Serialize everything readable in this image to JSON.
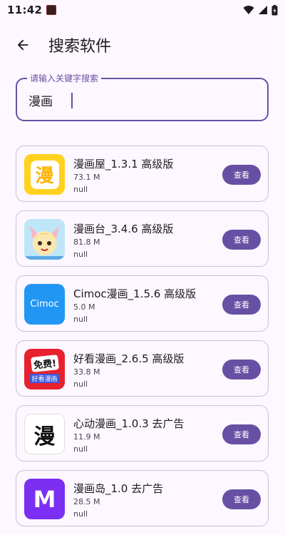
{
  "status_bar": {
    "time": "11:42",
    "icons": [
      "app-notification-icon",
      "wifi-icon",
      "cellular-signal-icon",
      "battery-icon"
    ]
  },
  "header": {
    "back_icon": "arrow-back-icon",
    "title": "搜索软件"
  },
  "search": {
    "label": "请输入关键字搜索",
    "value": "漫画"
  },
  "apps": [
    {
      "name": "漫画屋_1.3.1 高级版",
      "size": "73.1 M",
      "desc": "null",
      "button": "查看",
      "icon_text": "漫",
      "icon_bg": "#ffd21f",
      "icon_fg": "#ffffff"
    },
    {
      "name": "漫画台_3.4.6 高级版",
      "size": "81.8 M",
      "desc": "null",
      "button": "查看",
      "icon_text": "",
      "icon_bg": "#bfe6f7",
      "icon_fg": "#ffffff"
    },
    {
      "name": "Cimoc漫画_1.5.6 高级版",
      "size": "5.0 M",
      "desc": "null",
      "button": "查看",
      "icon_text": "Cimoc",
      "icon_bg": "#2196f3",
      "icon_fg": "#ffffff"
    },
    {
      "name": "好看漫画_2.6.5 高级版",
      "size": "33.8 M",
      "desc": "null",
      "button": "查看",
      "icon_text": "免费!",
      "icon_sub": "好看漫画",
      "icon_bg": "#e8212e",
      "icon_fg": "#ffffff"
    },
    {
      "name": "心动漫画_1.0.3 去广告",
      "size": "11.9 M",
      "desc": "null",
      "button": "查看",
      "icon_text": "漫",
      "icon_bg": "#ffffff",
      "icon_fg": "#111111"
    },
    {
      "name": "漫画岛_1.0 去广告",
      "size": "28.5 M",
      "desc": "null",
      "button": "查看",
      "icon_text": "M",
      "icon_bg": "#7b2ff2",
      "icon_fg": "#ffffff"
    }
  ],
  "colors": {
    "accent": "#6750a4",
    "background": "#fdf7ff",
    "card_border": "#cac4d0"
  }
}
